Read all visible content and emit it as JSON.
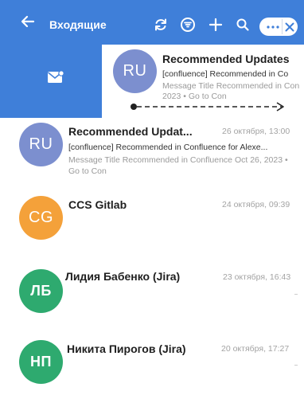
{
  "topbar": {
    "title": "Входящие",
    "icons": [
      "back-arrow-icon",
      "refresh-icon",
      "filter-icon",
      "plus-icon",
      "search-icon",
      "more-icon",
      "close-icon"
    ],
    "color": "#3f7fd9"
  },
  "swipe": {
    "action_icon": "mail-read-icon",
    "message": {
      "initials": "RU",
      "sender": "Recommended Updates",
      "subject": "[confluence] Recommended in Co",
      "preview": "Message Title Recommended in Con 2023 • Go to Con"
    }
  },
  "messages": [
    {
      "initials": "RU",
      "sender": "Recommended Updat...",
      "date": "26 октября, 13:00",
      "subject": "[confluence] Recommended in Confluence for Alexe...",
      "preview": "Message Title Recommended in Confluence Oct 26, 2023 • Go to Con",
      "avatar_color": "#7c8fcf"
    },
    {
      "initials": "CG",
      "sender": "CCS Gitlab",
      "date": "24 октября, 09:39",
      "avatar_color": "#f4a13a"
    },
    {
      "initials": "ЛБ",
      "sender": "Лидия Бабенко (Jira)",
      "date": "23 октября, 16:43",
      "avatar_color": "#2eaa6f"
    },
    {
      "initials": "НП",
      "sender": "Никита Пирогов (Jira)",
      "date": "20 октября, 17:27",
      "avatar_color": "#2eaa6f"
    }
  ]
}
